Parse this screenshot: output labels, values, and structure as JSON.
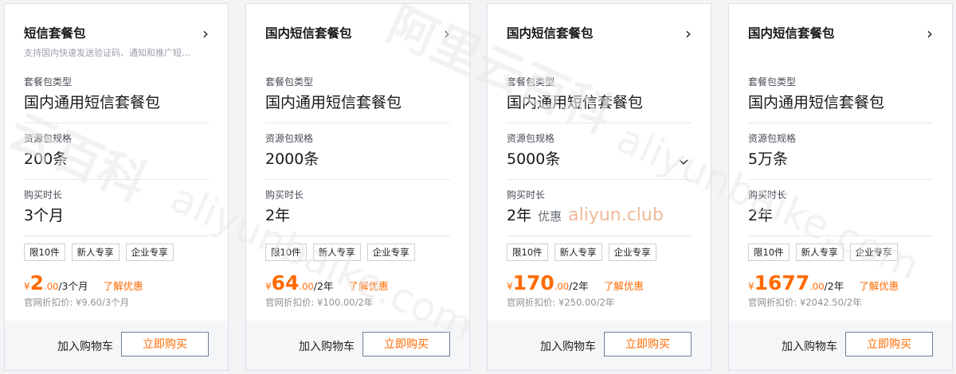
{
  "cards": [
    {
      "title": "短信套餐包",
      "arrow": "›",
      "description": "支持国内快速发送验证码、通知和推广短…",
      "type_label": "套餐包类型",
      "type_value": "国内通用短信套餐包",
      "spec_label": "资源包规格",
      "spec_value": "200条",
      "duration_label": "购买时长",
      "duration_value": "3个月",
      "tags": [
        "限10件",
        "新人专享",
        "企业专享"
      ],
      "currency": "¥",
      "price_int": "2",
      "price_dec": ".00",
      "price_unit": "/3个月",
      "discount_link": "了解优惠",
      "official_price": "官网折扣价: ¥9.60/3个月",
      "cart_label": "加入购物车",
      "buy_label": "立即购买"
    },
    {
      "title": "国内短信套餐包",
      "arrow": "›",
      "type_label": "套餐包类型",
      "type_value": "国内通用短信套餐包",
      "spec_label": "资源包规格",
      "spec_value": "2000条",
      "duration_label": "购买时长",
      "duration_value": "2年",
      "tags": [
        "限10件",
        "新人专享",
        "企业专享"
      ],
      "currency": "¥",
      "price_int": "64",
      "price_dec": ".00",
      "price_unit": "/2年",
      "discount_link": "了解优惠",
      "official_price": "官网折扣价: ¥100.00/2年",
      "cart_label": "加入购物车",
      "buy_label": "立即购买"
    },
    {
      "title": "国内短信套餐包",
      "arrow": "›",
      "type_label": "套餐包类型",
      "type_value": "国内通用短信套餐包",
      "spec_label": "资源包规格",
      "spec_value": "5000条",
      "spec_dropdown_icon": "chevron-down-icon",
      "duration_label": "购买时长",
      "duration_value": "2年",
      "duration_promo": "优惠",
      "watermark_inline": "aliyun.club",
      "tags": [
        "限10件",
        "新人专享",
        "企业专享"
      ],
      "currency": "¥",
      "price_int": "170",
      "price_dec": ".00",
      "price_unit": "/2年",
      "discount_link": "了解优惠",
      "official_price": "官网折扣价: ¥250.00/2年",
      "cart_label": "加入购物车",
      "buy_label": "立即购买"
    },
    {
      "title": "国内短信套餐包",
      "arrow": "›",
      "type_label": "套餐包类型",
      "type_value": "国内通用短信套餐包",
      "spec_label": "资源包规格",
      "spec_value": "5万条",
      "duration_label": "购买时长",
      "duration_value": "2年",
      "tags": [
        "限10件",
        "新人专享",
        "企业专享"
      ],
      "currency": "¥",
      "price_int": "1677",
      "price_dec": ".00",
      "price_unit": "/2年",
      "discount_link": "了解优惠",
      "official_price": "官网折扣价: ¥2042.50/2年",
      "cart_label": "加入购物车",
      "buy_label": "立即购买"
    }
  ],
  "watermarks": {
    "cn_top": "阿里云百科",
    "en_top": "aliyunbaike.com",
    "cn_left": "云百科",
    "en_left": "aliyunbaike.com"
  },
  "colors": {
    "accent": "#ff6a00",
    "border": "#dcdfe5",
    "footer_bg": "#f5f6f8"
  }
}
